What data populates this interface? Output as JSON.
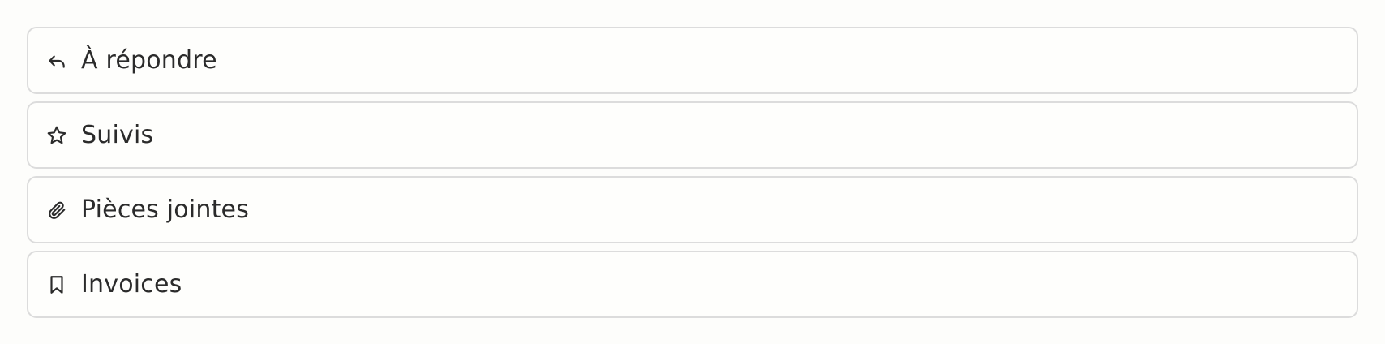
{
  "filters": {
    "items": [
      {
        "icon": "reply-icon",
        "label": "À répondre"
      },
      {
        "icon": "star-icon",
        "label": "Suivis"
      },
      {
        "icon": "paperclip-icon",
        "label": "Pièces jointes"
      },
      {
        "icon": "bookmark-icon",
        "label": "Invoices"
      }
    ]
  },
  "colors": {
    "text": "#2b2b2b",
    "border": "#dcdcdc",
    "background": "#fdfdfb"
  }
}
